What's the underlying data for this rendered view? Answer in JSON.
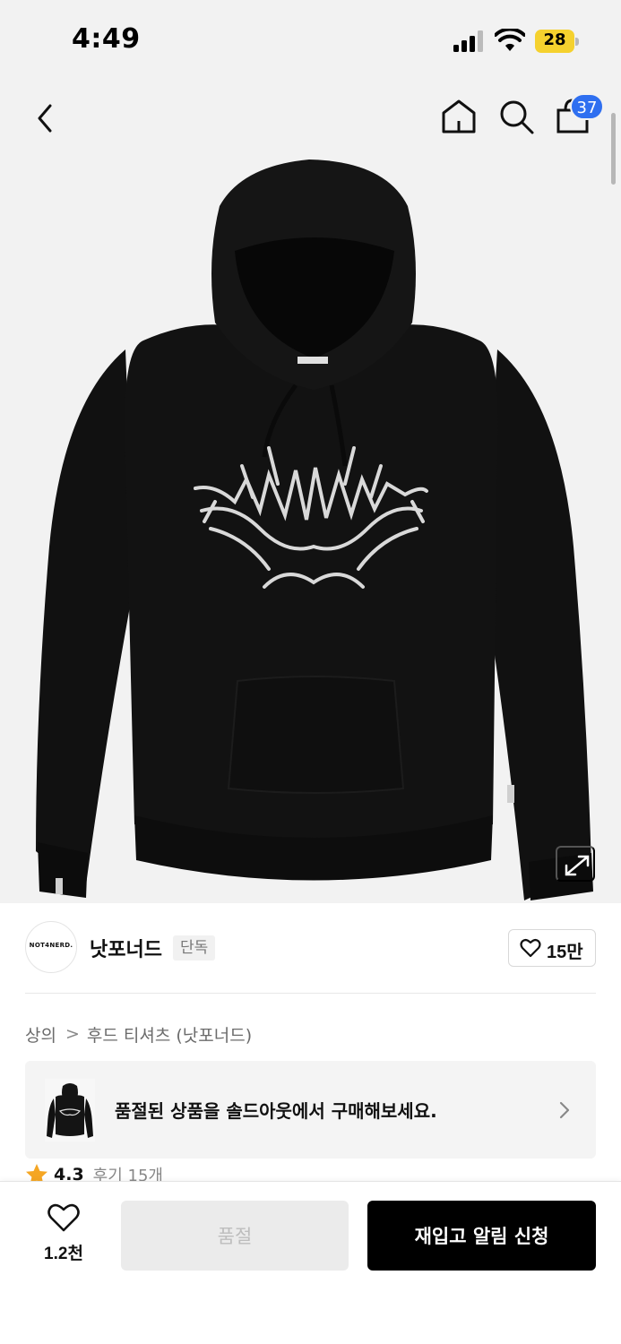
{
  "status_bar": {
    "time": "4:49",
    "battery_level": "28",
    "icons": [
      "cellular-signal-icon",
      "wifi-icon",
      "battery-icon"
    ]
  },
  "nav": {
    "back_icon": "chevron-left-icon",
    "home_icon": "home-icon",
    "search_icon": "search-icon",
    "cart_icon": "shopping-bag-icon",
    "cart_badge_count": "37",
    "badge_color": "#2f6ff0"
  },
  "product_image": {
    "expand_icon": "expand-arrows-icon"
  },
  "brand": {
    "logo_text": "NOT4NERD.",
    "name": "낫포너드",
    "tag": "단독",
    "like_icon": "heart-outline-icon",
    "like_count": "15만"
  },
  "breadcrumb": {
    "items": [
      "상의",
      "후드 티셔츠 (낫포너드)"
    ],
    "separator": ">"
  },
  "soldout_banner": {
    "text": "품절된 상품을 솔드아웃에서 구매해보세요.",
    "chevron_icon": "chevron-right-icon"
  },
  "rating": {
    "star_icon": "star-icon",
    "score": "4.3",
    "review_label": "후기 15개",
    "star_color": "#f5a623"
  },
  "bottom_bar": {
    "wish_icon": "heart-outline-icon",
    "wish_count": "1.2천",
    "soldout_label": "품절",
    "restock_label": "재입고 알림 신청"
  }
}
